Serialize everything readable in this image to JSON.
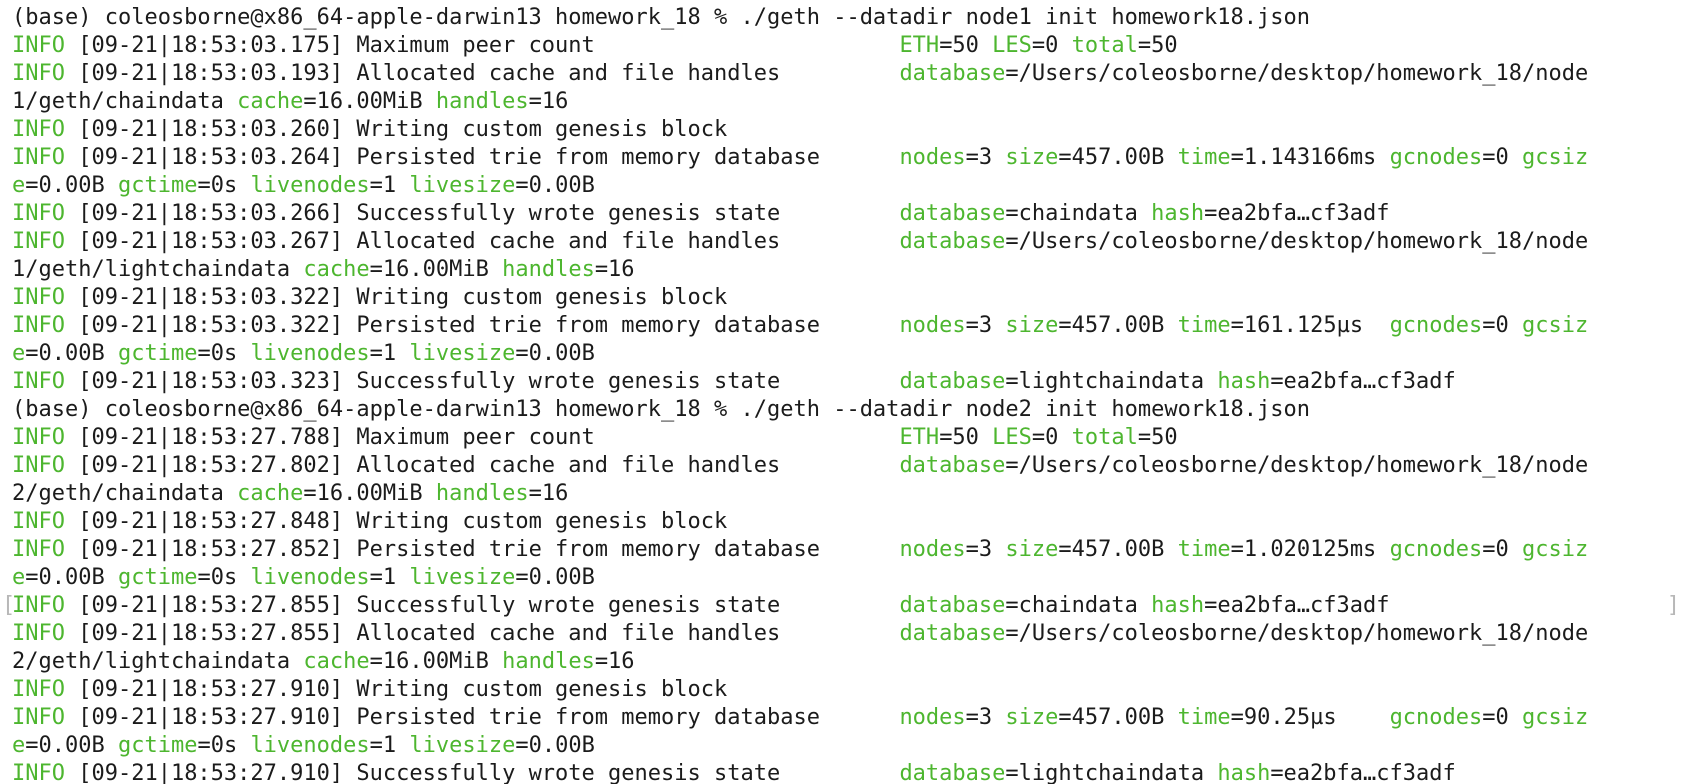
{
  "colors": {
    "background": "#ffffff",
    "text": "#1b1b1b",
    "key_green": "#4db62f",
    "selection_bracket": "#b8b8b8"
  },
  "terminal": {
    "lines": [
      {
        "segments": [
          [
            "(base) coleosborne@x86_64-apple-darwin13 homework_18 % ./geth --datadir node1 init homework18.json",
            0
          ]
        ]
      },
      {
        "segments": [
          [
            "INFO",
            1
          ],
          [
            " [09-21|18:53:03.175] Maximum peer count                       ",
            0
          ],
          [
            "ETH",
            1
          ],
          [
            "=50 ",
            0
          ],
          [
            "LES",
            1
          ],
          [
            "=0 ",
            0
          ],
          [
            "total",
            1
          ],
          [
            "=50",
            0
          ]
        ]
      },
      {
        "segments": [
          [
            "INFO",
            1
          ],
          [
            " [09-21|18:53:03.193] Allocated cache and file handles         ",
            0
          ],
          [
            "database",
            1
          ],
          [
            "=/Users/coleosborne/desktop/homework_18/node",
            0
          ]
        ]
      },
      {
        "segments": [
          [
            "1/geth/chaindata ",
            0
          ],
          [
            "cache",
            1
          ],
          [
            "=16.00MiB ",
            0
          ],
          [
            "handles",
            1
          ],
          [
            "=16",
            0
          ]
        ]
      },
      {
        "segments": [
          [
            "INFO",
            1
          ],
          [
            " [09-21|18:53:03.260] Writing custom genesis block",
            0
          ]
        ]
      },
      {
        "segments": [
          [
            "INFO",
            1
          ],
          [
            " [09-21|18:53:03.264] Persisted trie from memory database      ",
            0
          ],
          [
            "nodes",
            1
          ],
          [
            "=3 ",
            0
          ],
          [
            "size",
            1
          ],
          [
            "=457.00B ",
            0
          ],
          [
            "time",
            1
          ],
          [
            "=1.143166ms ",
            0
          ],
          [
            "gcnodes",
            1
          ],
          [
            "=0 ",
            0
          ],
          [
            "gcsiz",
            1
          ]
        ]
      },
      {
        "segments": [
          [
            "e",
            1
          ],
          [
            "=0.00B ",
            0
          ],
          [
            "gctime",
            1
          ],
          [
            "=0s ",
            0
          ],
          [
            "livenodes",
            1
          ],
          [
            "=1 ",
            0
          ],
          [
            "livesize",
            1
          ],
          [
            "=0.00B",
            0
          ]
        ]
      },
      {
        "segments": [
          [
            "INFO",
            1
          ],
          [
            " [09-21|18:53:03.266] Successfully wrote genesis state         ",
            0
          ],
          [
            "database",
            1
          ],
          [
            "=chaindata ",
            0
          ],
          [
            "hash",
            1
          ],
          [
            "=ea2bfa…cf3adf",
            0
          ]
        ]
      },
      {
        "segments": [
          [
            "INFO",
            1
          ],
          [
            " [09-21|18:53:03.267] Allocated cache and file handles         ",
            0
          ],
          [
            "database",
            1
          ],
          [
            "=/Users/coleosborne/desktop/homework_18/node",
            0
          ]
        ]
      },
      {
        "segments": [
          [
            "1/geth/lightchaindata ",
            0
          ],
          [
            "cache",
            1
          ],
          [
            "=16.00MiB ",
            0
          ],
          [
            "handles",
            1
          ],
          [
            "=16",
            0
          ]
        ]
      },
      {
        "segments": [
          [
            "INFO",
            1
          ],
          [
            " [09-21|18:53:03.322] Writing custom genesis block",
            0
          ]
        ]
      },
      {
        "segments": [
          [
            "INFO",
            1
          ],
          [
            " [09-21|18:53:03.322] Persisted trie from memory database      ",
            0
          ],
          [
            "nodes",
            1
          ],
          [
            "=3 ",
            0
          ],
          [
            "size",
            1
          ],
          [
            "=457.00B ",
            0
          ],
          [
            "time",
            1
          ],
          [
            "=161.125µs  ",
            0
          ],
          [
            "gcnodes",
            1
          ],
          [
            "=0 ",
            0
          ],
          [
            "gcsiz",
            1
          ]
        ]
      },
      {
        "segments": [
          [
            "e",
            1
          ],
          [
            "=0.00B ",
            0
          ],
          [
            "gctime",
            1
          ],
          [
            "=0s ",
            0
          ],
          [
            "livenodes",
            1
          ],
          [
            "=1 ",
            0
          ],
          [
            "livesize",
            1
          ],
          [
            "=0.00B",
            0
          ]
        ]
      },
      {
        "segments": [
          [
            "INFO",
            1
          ],
          [
            " [09-21|18:53:03.323] Successfully wrote genesis state         ",
            0
          ],
          [
            "database",
            1
          ],
          [
            "=lightchaindata ",
            0
          ],
          [
            "hash",
            1
          ],
          [
            "=ea2bfa…cf3adf",
            0
          ]
        ]
      },
      {
        "segments": [
          [
            "(base) coleosborne@x86_64-apple-darwin13 homework_18 % ./geth --datadir node2 init homework18.json",
            0
          ]
        ]
      },
      {
        "segments": [
          [
            "INFO",
            1
          ],
          [
            " [09-21|18:53:27.788] Maximum peer count                       ",
            0
          ],
          [
            "ETH",
            1
          ],
          [
            "=50 ",
            0
          ],
          [
            "LES",
            1
          ],
          [
            "=0 ",
            0
          ],
          [
            "total",
            1
          ],
          [
            "=50",
            0
          ]
        ]
      },
      {
        "segments": [
          [
            "INFO",
            1
          ],
          [
            " [09-21|18:53:27.802] Allocated cache and file handles         ",
            0
          ],
          [
            "database",
            1
          ],
          [
            "=/Users/coleosborne/desktop/homework_18/node",
            0
          ]
        ]
      },
      {
        "segments": [
          [
            "2/geth/chaindata ",
            0
          ],
          [
            "cache",
            1
          ],
          [
            "=16.00MiB ",
            0
          ],
          [
            "handles",
            1
          ],
          [
            "=16",
            0
          ]
        ]
      },
      {
        "segments": [
          [
            "INFO",
            1
          ],
          [
            " [09-21|18:53:27.848] Writing custom genesis block",
            0
          ]
        ]
      },
      {
        "segments": [
          [
            "INFO",
            1
          ],
          [
            " [09-21|18:53:27.852] Persisted trie from memory database      ",
            0
          ],
          [
            "nodes",
            1
          ],
          [
            "=3 ",
            0
          ],
          [
            "size",
            1
          ],
          [
            "=457.00B ",
            0
          ],
          [
            "time",
            1
          ],
          [
            "=1.020125ms ",
            0
          ],
          [
            "gcnodes",
            1
          ],
          [
            "=0 ",
            0
          ],
          [
            "gcsiz",
            1
          ]
        ]
      },
      {
        "segments": [
          [
            "e",
            1
          ],
          [
            "=0.00B ",
            0
          ],
          [
            "gctime",
            1
          ],
          [
            "=0s ",
            0
          ],
          [
            "livenodes",
            1
          ],
          [
            "=1 ",
            0
          ],
          [
            "livesize",
            1
          ],
          [
            "=0.00B",
            0
          ]
        ]
      },
      {
        "segments": [
          [
            "INFO",
            1
          ],
          [
            " [09-21|18:53:27.855] Successfully wrote genesis state         ",
            0
          ],
          [
            "database",
            1
          ],
          [
            "=chaindata ",
            0
          ],
          [
            "hash",
            1
          ],
          [
            "=ea2bfa…cf3adf",
            0
          ]
        ],
        "marked": true
      },
      {
        "segments": [
          [
            "INFO",
            1
          ],
          [
            " [09-21|18:53:27.855] Allocated cache and file handles         ",
            0
          ],
          [
            "database",
            1
          ],
          [
            "=/Users/coleosborne/desktop/homework_18/node",
            0
          ]
        ]
      },
      {
        "segments": [
          [
            "2/geth/lightchaindata ",
            0
          ],
          [
            "cache",
            1
          ],
          [
            "=16.00MiB ",
            0
          ],
          [
            "handles",
            1
          ],
          [
            "=16",
            0
          ]
        ]
      },
      {
        "segments": [
          [
            "INFO",
            1
          ],
          [
            " [09-21|18:53:27.910] Writing custom genesis block",
            0
          ]
        ]
      },
      {
        "segments": [
          [
            "INFO",
            1
          ],
          [
            " [09-21|18:53:27.910] Persisted trie from memory database      ",
            0
          ],
          [
            "nodes",
            1
          ],
          [
            "=3 ",
            0
          ],
          [
            "size",
            1
          ],
          [
            "=457.00B ",
            0
          ],
          [
            "time",
            1
          ],
          [
            "=90.25µs    ",
            0
          ],
          [
            "gcnodes",
            1
          ],
          [
            "=0 ",
            0
          ],
          [
            "gcsiz",
            1
          ]
        ]
      },
      {
        "segments": [
          [
            "e",
            1
          ],
          [
            "=0.00B ",
            0
          ],
          [
            "gctime",
            1
          ],
          [
            "=0s ",
            0
          ],
          [
            "livenodes",
            1
          ],
          [
            "=1 ",
            0
          ],
          [
            "livesize",
            1
          ],
          [
            "=0.00B",
            0
          ]
        ]
      },
      {
        "segments": [
          [
            "INFO",
            1
          ],
          [
            " [09-21|18:53:27.910] Successfully wrote genesis state         ",
            0
          ],
          [
            "database",
            1
          ],
          [
            "=lightchaindata ",
            0
          ],
          [
            "hash",
            1
          ],
          [
            "=ea2bfa…cf3adf",
            0
          ]
        ]
      }
    ]
  }
}
